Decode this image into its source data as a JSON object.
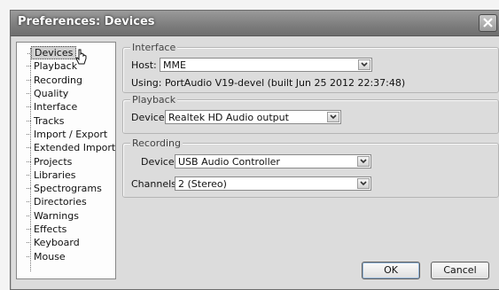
{
  "window": {
    "title": "Preferences: Devices"
  },
  "tree": {
    "items": [
      {
        "label": "Devices",
        "selected": true
      },
      {
        "label": "Playback"
      },
      {
        "label": "Recording"
      },
      {
        "label": "Quality"
      },
      {
        "label": "Interface"
      },
      {
        "label": "Tracks"
      },
      {
        "label": "Import / Export"
      },
      {
        "label": "Extended Import"
      },
      {
        "label": "Projects"
      },
      {
        "label": "Libraries"
      },
      {
        "label": "Spectrograms"
      },
      {
        "label": "Directories"
      },
      {
        "label": "Warnings"
      },
      {
        "label": "Effects"
      },
      {
        "label": "Keyboard"
      },
      {
        "label": "Mouse"
      }
    ]
  },
  "interface": {
    "group_label": "Interface",
    "host_label": "Host:",
    "host_value": "MME",
    "using_text": "Using: PortAudio V19-devel (built Jun 25 2012 22:37:48)"
  },
  "playback": {
    "group_label": "Playback",
    "device_label": "Device:",
    "device_value": "Realtek HD Audio output"
  },
  "recording": {
    "group_label": "Recording",
    "device_label": "Device:",
    "device_value": "USB Audio Controller",
    "channels_label": "Channels:",
    "channels_value": "2 (Stereo)"
  },
  "buttons": {
    "ok": "OK",
    "cancel": "Cancel"
  }
}
